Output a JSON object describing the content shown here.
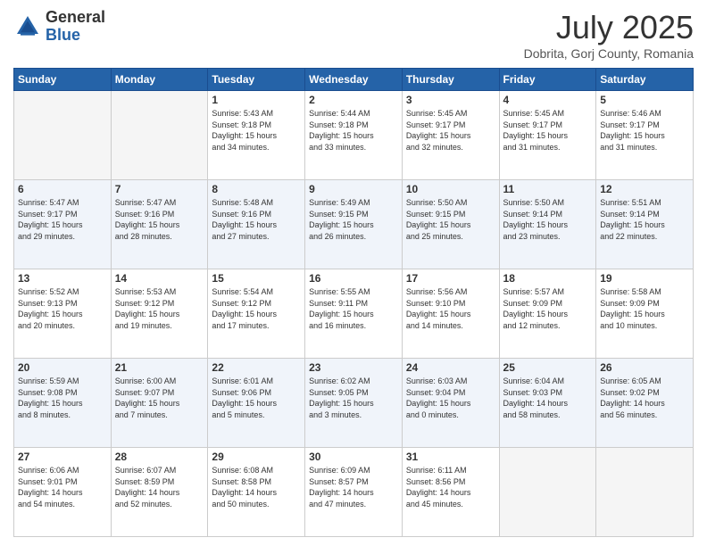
{
  "header": {
    "logo_general": "General",
    "logo_blue": "Blue",
    "month_title": "July 2025",
    "location": "Dobrita, Gorj County, Romania"
  },
  "days_of_week": [
    "Sunday",
    "Monday",
    "Tuesday",
    "Wednesday",
    "Thursday",
    "Friday",
    "Saturday"
  ],
  "weeks": [
    [
      {
        "day": "",
        "info": ""
      },
      {
        "day": "",
        "info": ""
      },
      {
        "day": "1",
        "info": "Sunrise: 5:43 AM\nSunset: 9:18 PM\nDaylight: 15 hours\nand 34 minutes."
      },
      {
        "day": "2",
        "info": "Sunrise: 5:44 AM\nSunset: 9:18 PM\nDaylight: 15 hours\nand 33 minutes."
      },
      {
        "day": "3",
        "info": "Sunrise: 5:45 AM\nSunset: 9:17 PM\nDaylight: 15 hours\nand 32 minutes."
      },
      {
        "day": "4",
        "info": "Sunrise: 5:45 AM\nSunset: 9:17 PM\nDaylight: 15 hours\nand 31 minutes."
      },
      {
        "day": "5",
        "info": "Sunrise: 5:46 AM\nSunset: 9:17 PM\nDaylight: 15 hours\nand 31 minutes."
      }
    ],
    [
      {
        "day": "6",
        "info": "Sunrise: 5:47 AM\nSunset: 9:17 PM\nDaylight: 15 hours\nand 29 minutes."
      },
      {
        "day": "7",
        "info": "Sunrise: 5:47 AM\nSunset: 9:16 PM\nDaylight: 15 hours\nand 28 minutes."
      },
      {
        "day": "8",
        "info": "Sunrise: 5:48 AM\nSunset: 9:16 PM\nDaylight: 15 hours\nand 27 minutes."
      },
      {
        "day": "9",
        "info": "Sunrise: 5:49 AM\nSunset: 9:15 PM\nDaylight: 15 hours\nand 26 minutes."
      },
      {
        "day": "10",
        "info": "Sunrise: 5:50 AM\nSunset: 9:15 PM\nDaylight: 15 hours\nand 25 minutes."
      },
      {
        "day": "11",
        "info": "Sunrise: 5:50 AM\nSunset: 9:14 PM\nDaylight: 15 hours\nand 23 minutes."
      },
      {
        "day": "12",
        "info": "Sunrise: 5:51 AM\nSunset: 9:14 PM\nDaylight: 15 hours\nand 22 minutes."
      }
    ],
    [
      {
        "day": "13",
        "info": "Sunrise: 5:52 AM\nSunset: 9:13 PM\nDaylight: 15 hours\nand 20 minutes."
      },
      {
        "day": "14",
        "info": "Sunrise: 5:53 AM\nSunset: 9:12 PM\nDaylight: 15 hours\nand 19 minutes."
      },
      {
        "day": "15",
        "info": "Sunrise: 5:54 AM\nSunset: 9:12 PM\nDaylight: 15 hours\nand 17 minutes."
      },
      {
        "day": "16",
        "info": "Sunrise: 5:55 AM\nSunset: 9:11 PM\nDaylight: 15 hours\nand 16 minutes."
      },
      {
        "day": "17",
        "info": "Sunrise: 5:56 AM\nSunset: 9:10 PM\nDaylight: 15 hours\nand 14 minutes."
      },
      {
        "day": "18",
        "info": "Sunrise: 5:57 AM\nSunset: 9:09 PM\nDaylight: 15 hours\nand 12 minutes."
      },
      {
        "day": "19",
        "info": "Sunrise: 5:58 AM\nSunset: 9:09 PM\nDaylight: 15 hours\nand 10 minutes."
      }
    ],
    [
      {
        "day": "20",
        "info": "Sunrise: 5:59 AM\nSunset: 9:08 PM\nDaylight: 15 hours\nand 8 minutes."
      },
      {
        "day": "21",
        "info": "Sunrise: 6:00 AM\nSunset: 9:07 PM\nDaylight: 15 hours\nand 7 minutes."
      },
      {
        "day": "22",
        "info": "Sunrise: 6:01 AM\nSunset: 9:06 PM\nDaylight: 15 hours\nand 5 minutes."
      },
      {
        "day": "23",
        "info": "Sunrise: 6:02 AM\nSunset: 9:05 PM\nDaylight: 15 hours\nand 3 minutes."
      },
      {
        "day": "24",
        "info": "Sunrise: 6:03 AM\nSunset: 9:04 PM\nDaylight: 15 hours\nand 0 minutes."
      },
      {
        "day": "25",
        "info": "Sunrise: 6:04 AM\nSunset: 9:03 PM\nDaylight: 14 hours\nand 58 minutes."
      },
      {
        "day": "26",
        "info": "Sunrise: 6:05 AM\nSunset: 9:02 PM\nDaylight: 14 hours\nand 56 minutes."
      }
    ],
    [
      {
        "day": "27",
        "info": "Sunrise: 6:06 AM\nSunset: 9:01 PM\nDaylight: 14 hours\nand 54 minutes."
      },
      {
        "day": "28",
        "info": "Sunrise: 6:07 AM\nSunset: 8:59 PM\nDaylight: 14 hours\nand 52 minutes."
      },
      {
        "day": "29",
        "info": "Sunrise: 6:08 AM\nSunset: 8:58 PM\nDaylight: 14 hours\nand 50 minutes."
      },
      {
        "day": "30",
        "info": "Sunrise: 6:09 AM\nSunset: 8:57 PM\nDaylight: 14 hours\nand 47 minutes."
      },
      {
        "day": "31",
        "info": "Sunrise: 6:11 AM\nSunset: 8:56 PM\nDaylight: 14 hours\nand 45 minutes."
      },
      {
        "day": "",
        "info": ""
      },
      {
        "day": "",
        "info": ""
      }
    ]
  ]
}
